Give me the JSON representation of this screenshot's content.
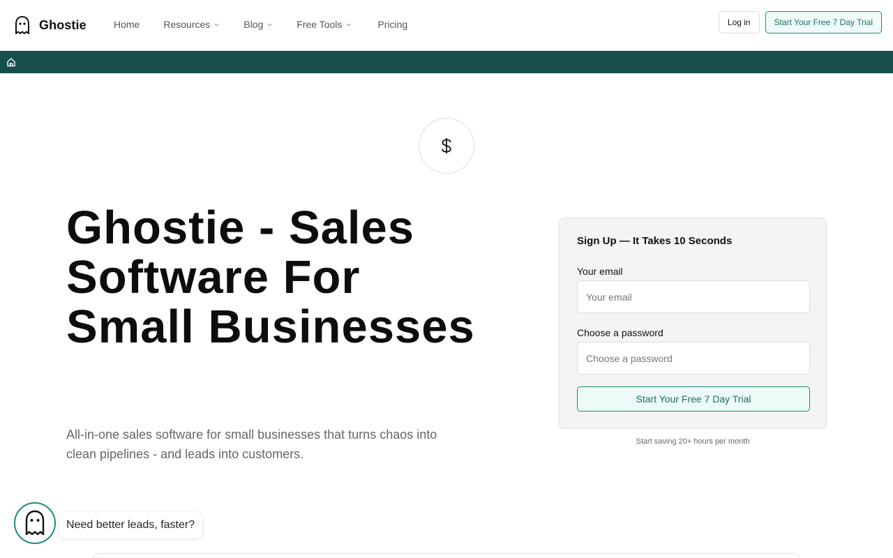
{
  "header": {
    "brand": "Ghostie",
    "nav": [
      {
        "label": "Home",
        "dropdown": false
      },
      {
        "label": "Resources",
        "dropdown": true
      },
      {
        "label": "Blog",
        "dropdown": true
      },
      {
        "label": "Free Tools",
        "dropdown": true
      },
      {
        "label": "Pricing",
        "dropdown": false
      }
    ],
    "login_label": "Log in",
    "trial_label": "Start Your Free 7 Day Trial"
  },
  "breadcrumb": {
    "icon": "home-icon"
  },
  "badge": {
    "icon": "dollar-icon"
  },
  "hero": {
    "title": "Ghostie - Sales Software For Small Businesses",
    "subtitle": "All-in-one sales software for small businesses that turns chaos into clean pipelines - and leads into customers."
  },
  "signup": {
    "title": "Sign Up — It Takes 10 Seconds",
    "email_label": "Your email",
    "email_placeholder": "Your email",
    "email_value": "",
    "password_label": "Choose a password",
    "password_placeholder": "Choose a password",
    "password_value": "",
    "submit_label": "Start Your Free 7 Day Trial",
    "note": "Start saving 20+ hours per month"
  },
  "chat": {
    "message": "Need better leads, faster?"
  },
  "colors": {
    "accent": "#1c8a7c",
    "bar": "#164e4a"
  }
}
